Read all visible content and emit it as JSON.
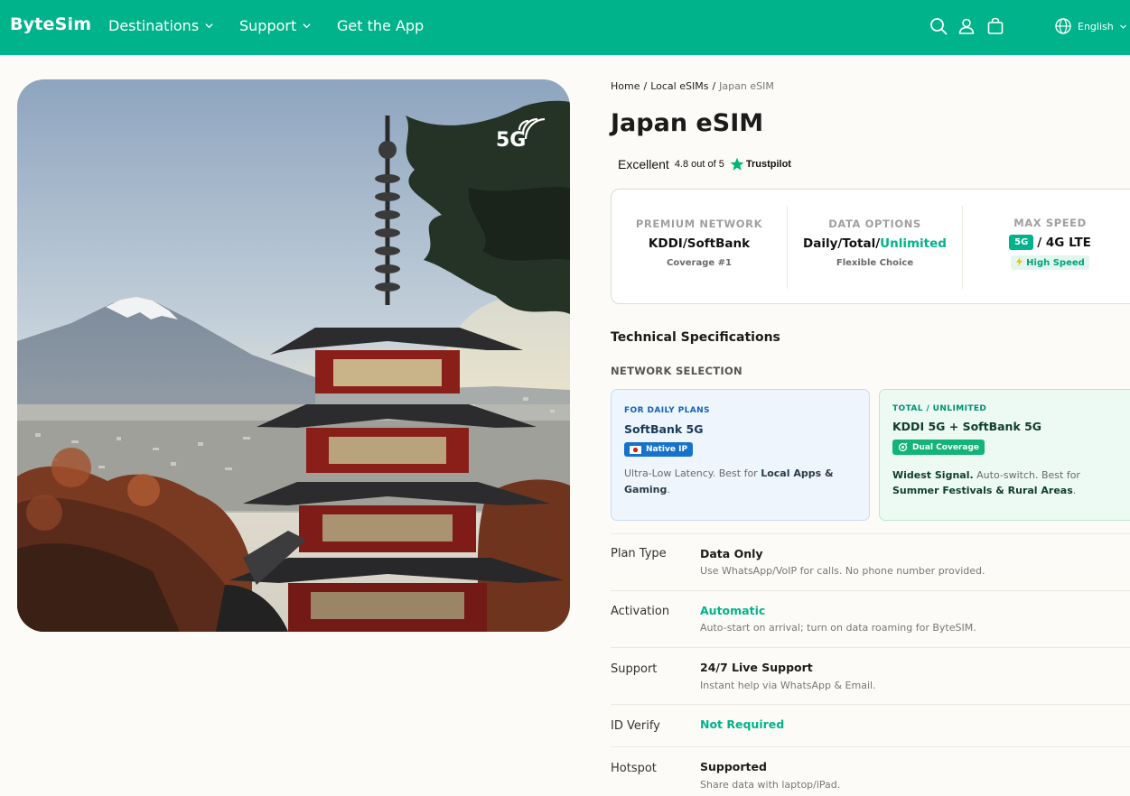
{
  "header": {
    "logo": "ByteSim",
    "nav": [
      {
        "label": "Destinations",
        "dropdown": true
      },
      {
        "label": "Support",
        "dropdown": true
      },
      {
        "label": "Get the App",
        "dropdown": false
      }
    ],
    "icons": [
      "search-icon",
      "user-icon",
      "bag-icon",
      "globe-icon"
    ],
    "language": "English",
    "bg_color": "#00b38a"
  },
  "hero": {
    "badge": "5G",
    "scene": "Japanese pagoda with Mount Fuji"
  },
  "breadcrumb": {
    "home": "Home",
    "category": "Local eSIMs",
    "current": "Japan eSIM",
    "separator": "/"
  },
  "product": {
    "title": "Japan eSIM",
    "rating": {
      "label": "Excellent",
      "score_text": "4.8 out of 5",
      "provider": "Trustpilot"
    }
  },
  "features": [
    {
      "heading": "PREMIUM NETWORK",
      "value": "KDDI/SoftBank",
      "sub": "Coverage #1"
    },
    {
      "heading": "DATA OPTIONS",
      "value_prefix": "Daily/Total/",
      "value_highlight": "Unlimited",
      "sub": "Flexible Choice"
    },
    {
      "heading": "MAX SPEED",
      "badge": "5G",
      "value_suffix": "/ 4G LTE",
      "sub": "High Speed"
    }
  ],
  "tech": {
    "heading": "Technical Specifications",
    "network_selection": "NETWORK SELECTION",
    "cards": [
      {
        "kicker": "FOR DAILY PLANS",
        "title": "SoftBank 5G",
        "pill": "Native IP",
        "desc_pre": "Ultra-Low Latency. Best for ",
        "desc_bold": "Local Apps & Gaming",
        "desc_post": "."
      },
      {
        "kicker": "TOTAL / UNLIMITED",
        "title": "KDDI 5G + SoftBank 5G",
        "pill": "Dual Coverage",
        "desc_bold_1": "Widest Signal.",
        "desc_mid": " Auto-switch. Best for ",
        "desc_bold_2": "Summer Festivals & Rural Areas",
        "desc_post": "."
      }
    ],
    "specs": [
      {
        "label": "Plan Type",
        "value": "Data Only",
        "sub": "Use WhatsApp/VoIP for calls. No phone number provided."
      },
      {
        "label": "Activation",
        "value": "Automatic",
        "sub": "Auto-start on arrival; turn on data roaming for ByteSIM.",
        "accent": true
      },
      {
        "label": "Support",
        "value": "24/7 Live Support",
        "sub": "Instant help via WhatsApp & Email."
      },
      {
        "label": "ID Verify",
        "value": "Not Required",
        "sub": "",
        "accent": true
      },
      {
        "label": "Hotspot",
        "value": "Supported",
        "sub": "Share data with laptop/iPad."
      }
    ]
  }
}
